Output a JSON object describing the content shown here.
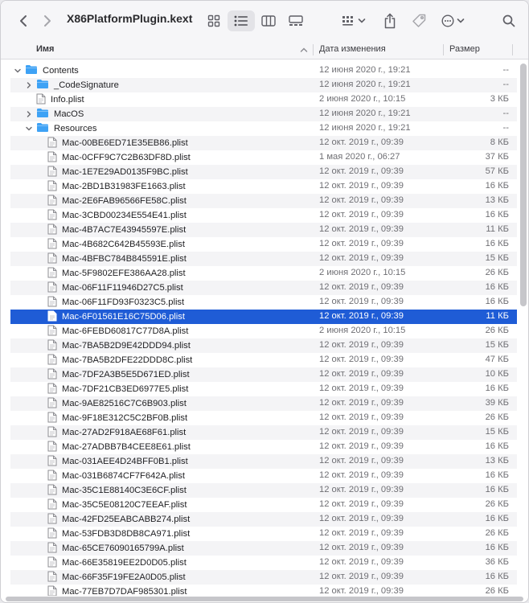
{
  "window": {
    "title": "X86PlatformPlugin.kext"
  },
  "columns": {
    "name": "Имя",
    "date": "Дата изменения",
    "size": "Размер"
  },
  "rows": [
    {
      "name": "Contents",
      "date": "12 июня 2020 г., 19:21",
      "size": "--",
      "type": "folder",
      "level": 0,
      "disclosure": "open"
    },
    {
      "name": "_CodeSignature",
      "date": "12 июня 2020 г., 19:21",
      "size": "--",
      "type": "folder",
      "level": 1,
      "disclosure": "closed"
    },
    {
      "name": "Info.plist",
      "date": "2 июня 2020 г., 10:15",
      "size": "3 КБ",
      "type": "file",
      "level": 1,
      "disclosure": "none"
    },
    {
      "name": "MacOS",
      "date": "12 июня 2020 г., 19:21",
      "size": "--",
      "type": "folder",
      "level": 1,
      "disclosure": "closed"
    },
    {
      "name": "Resources",
      "date": "12 июня 2020 г., 19:21",
      "size": "--",
      "type": "folder",
      "level": 1,
      "disclosure": "open"
    },
    {
      "name": "Mac-00BE6ED71E35EB86.plist",
      "date": "12 окт. 2019 г., 09:39",
      "size": "8 КБ",
      "type": "file",
      "level": 2,
      "disclosure": "none"
    },
    {
      "name": "Mac-0CFF9C7C2B63DF8D.plist",
      "date": "1 мая 2020 г., 06:27",
      "size": "37 КБ",
      "type": "file",
      "level": 2,
      "disclosure": "none"
    },
    {
      "name": "Mac-1E7E29AD0135F9BC.plist",
      "date": "12 окт. 2019 г., 09:39",
      "size": "57 КБ",
      "type": "file",
      "level": 2,
      "disclosure": "none"
    },
    {
      "name": "Mac-2BD1B31983FE1663.plist",
      "date": "12 окт. 2019 г., 09:39",
      "size": "16 КБ",
      "type": "file",
      "level": 2,
      "disclosure": "none"
    },
    {
      "name": "Mac-2E6FAB96566FE58C.plist",
      "date": "12 окт. 2019 г., 09:39",
      "size": "13 КБ",
      "type": "file",
      "level": 2,
      "disclosure": "none"
    },
    {
      "name": "Mac-3CBD00234E554E41.plist",
      "date": "12 окт. 2019 г., 09:39",
      "size": "16 КБ",
      "type": "file",
      "level": 2,
      "disclosure": "none"
    },
    {
      "name": "Mac-4B7AC7E43945597E.plist",
      "date": "12 окт. 2019 г., 09:39",
      "size": "11 КБ",
      "type": "file",
      "level": 2,
      "disclosure": "none"
    },
    {
      "name": "Mac-4B682C642B45593E.plist",
      "date": "12 окт. 2019 г., 09:39",
      "size": "16 КБ",
      "type": "file",
      "level": 2,
      "disclosure": "none"
    },
    {
      "name": "Mac-4BFBC784B845591E.plist",
      "date": "12 окт. 2019 г., 09:39",
      "size": "15 КБ",
      "type": "file",
      "level": 2,
      "disclosure": "none"
    },
    {
      "name": "Mac-5F9802EFE386AA28.plist",
      "date": "2 июня 2020 г., 10:15",
      "size": "26 КБ",
      "type": "file",
      "level": 2,
      "disclosure": "none"
    },
    {
      "name": "Mac-06F11F11946D27C5.plist",
      "date": "12 окт. 2019 г., 09:39",
      "size": "16 КБ",
      "type": "file",
      "level": 2,
      "disclosure": "none"
    },
    {
      "name": "Mac-06F11FD93F0323C5.plist",
      "date": "12 окт. 2019 г., 09:39",
      "size": "16 КБ",
      "type": "file",
      "level": 2,
      "disclosure": "none"
    },
    {
      "name": "Mac-6F01561E16C75D06.plist",
      "date": "12 окт. 2019 г., 09:39",
      "size": "11 КБ",
      "type": "file",
      "level": 2,
      "disclosure": "none",
      "selected": true
    },
    {
      "name": "Mac-6FEBD60817C77D8A.plist",
      "date": "2 июня 2020 г., 10:15",
      "size": "26 КБ",
      "type": "file",
      "level": 2,
      "disclosure": "none"
    },
    {
      "name": "Mac-7BA5B2D9E42DDD94.plist",
      "date": "12 окт. 2019 г., 09:39",
      "size": "15 КБ",
      "type": "file",
      "level": 2,
      "disclosure": "none"
    },
    {
      "name": "Mac-7BA5B2DFE22DDD8C.plist",
      "date": "12 окт. 2019 г., 09:39",
      "size": "47 КБ",
      "type": "file",
      "level": 2,
      "disclosure": "none"
    },
    {
      "name": "Mac-7DF2A3B5E5D671ED.plist",
      "date": "12 окт. 2019 г., 09:39",
      "size": "10 КБ",
      "type": "file",
      "level": 2,
      "disclosure": "none"
    },
    {
      "name": "Mac-7DF21CB3ED6977E5.plist",
      "date": "12 окт. 2019 г., 09:39",
      "size": "16 КБ",
      "type": "file",
      "level": 2,
      "disclosure": "none"
    },
    {
      "name": "Mac-9AE82516C7C6B903.plist",
      "date": "12 окт. 2019 г., 09:39",
      "size": "39 КБ",
      "type": "file",
      "level": 2,
      "disclosure": "none"
    },
    {
      "name": "Mac-9F18E312C5C2BF0B.plist",
      "date": "12 окт. 2019 г., 09:39",
      "size": "26 КБ",
      "type": "file",
      "level": 2,
      "disclosure": "none"
    },
    {
      "name": "Mac-27AD2F918AE68F61.plist",
      "date": "12 окт. 2019 г., 09:39",
      "size": "15 КБ",
      "type": "file",
      "level": 2,
      "disclosure": "none"
    },
    {
      "name": "Mac-27ADBB7B4CEE8E61.plist",
      "date": "12 окт. 2019 г., 09:39",
      "size": "16 КБ",
      "type": "file",
      "level": 2,
      "disclosure": "none"
    },
    {
      "name": "Mac-031AEE4D24BFF0B1.plist",
      "date": "12 окт. 2019 г., 09:39",
      "size": "13 КБ",
      "type": "file",
      "level": 2,
      "disclosure": "none"
    },
    {
      "name": "Mac-031B6874CF7F642A.plist",
      "date": "12 окт. 2019 г., 09:39",
      "size": "16 КБ",
      "type": "file",
      "level": 2,
      "disclosure": "none"
    },
    {
      "name": "Mac-35C1E88140C3E6CF.plist",
      "date": "12 окт. 2019 г., 09:39",
      "size": "16 КБ",
      "type": "file",
      "level": 2,
      "disclosure": "none"
    },
    {
      "name": "Mac-35C5E08120C7EEAF.plist",
      "date": "12 окт. 2019 г., 09:39",
      "size": "26 КБ",
      "type": "file",
      "level": 2,
      "disclosure": "none"
    },
    {
      "name": "Mac-42FD25EABCABB274.plist",
      "date": "12 окт. 2019 г., 09:39",
      "size": "16 КБ",
      "type": "file",
      "level": 2,
      "disclosure": "none"
    },
    {
      "name": "Mac-53FDB3D8DB8CA971.plist",
      "date": "12 окт. 2019 г., 09:39",
      "size": "26 КБ",
      "type": "file",
      "level": 2,
      "disclosure": "none"
    },
    {
      "name": "Mac-65CE76090165799A.plist",
      "date": "12 окт. 2019 г., 09:39",
      "size": "16 КБ",
      "type": "file",
      "level": 2,
      "disclosure": "none"
    },
    {
      "name": "Mac-66E35819EE2D0D05.plist",
      "date": "12 окт. 2019 г., 09:39",
      "size": "36 КБ",
      "type": "file",
      "level": 2,
      "disclosure": "none"
    },
    {
      "name": "Mac-66F35F19FE2A0D05.plist",
      "date": "12 окт. 2019 г., 09:39",
      "size": "16 КБ",
      "type": "file",
      "level": 2,
      "disclosure": "none"
    },
    {
      "name": "Mac-77EB7D7DAF985301.plist",
      "date": "12 окт. 2019 г., 09:39",
      "size": "26 КБ",
      "type": "file",
      "level": 2,
      "disclosure": "none"
    }
  ],
  "colors": {
    "selection": "#1f5cd6",
    "folder": "#3ea2f5",
    "stripe": "#f4f4f6"
  }
}
